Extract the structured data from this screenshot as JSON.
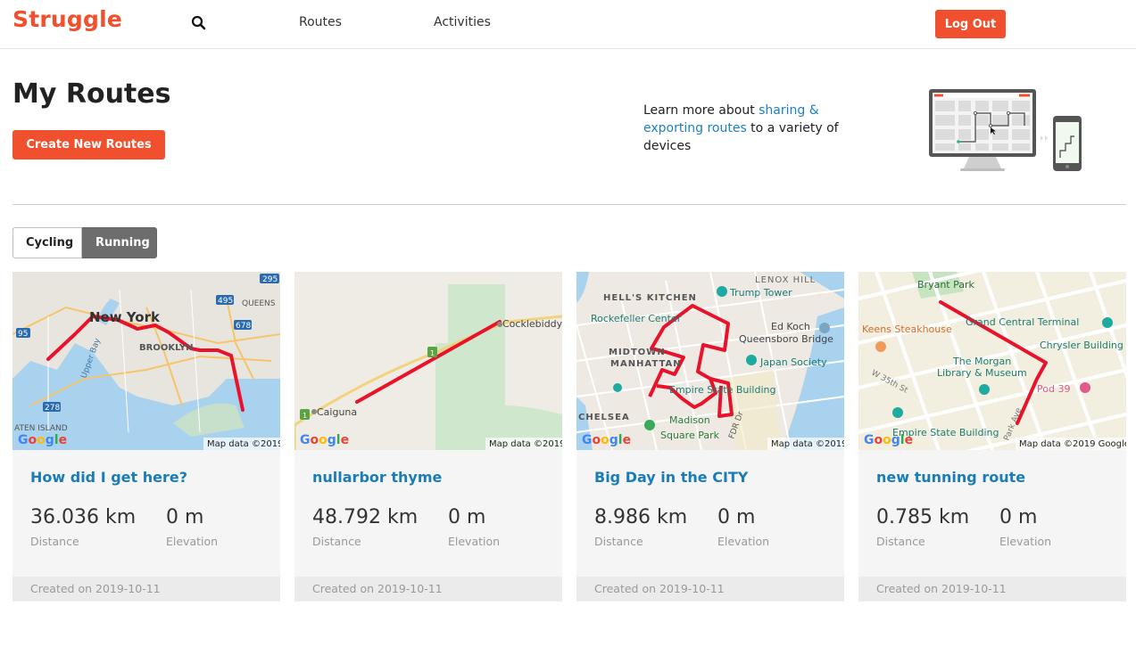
{
  "header": {
    "logo": "Struggle",
    "nav": [
      "Routes",
      "Activities"
    ],
    "logout_label": "Log Out"
  },
  "page": {
    "title": "My Routes",
    "create_label": "Create New Routes",
    "promo_prefix": "Learn more about ",
    "promo_link": "sharing & exporting routes",
    "promo_suffix": " to a variety of devices",
    "filter_tabs": [
      "Cycling",
      "Running"
    ],
    "selected_tab": "Running"
  },
  "cards": [
    {
      "title": "How did I get here?",
      "distance": "36.036 km",
      "distance_label": "Distance",
      "elevation": "0 m",
      "elevation_label": "Elevation",
      "created": "Created on 2019-10-11",
      "map_credit": "Map data ©2019",
      "map_labels": [
        "New York",
        "BROOKLYN",
        "Upper Bay",
        "QUEENS",
        "ATEN ISLAND"
      ]
    },
    {
      "title": "nullarbor thyme",
      "distance": "48.792 km",
      "distance_label": "Distance",
      "elevation": "0 m",
      "elevation_label": "Elevation",
      "created": "Created on 2019-10-11",
      "map_credit": "Map data ©2019",
      "map_labels": [
        "Cocklebiddy",
        "Caiguna"
      ]
    },
    {
      "title": "Big Day in the CITY",
      "distance": "8.986 km",
      "distance_label": "Distance",
      "elevation": "0 m",
      "elevation_label": "Elevation",
      "created": "Created on 2019-10-11",
      "map_credit": "Map data ©2019",
      "map_labels": [
        "LENOX HILL",
        "HELL'S KITCHEN",
        "Trump Tower",
        "Rockefeller Center",
        "Ed Koch",
        "Queensboro Bridge",
        "MIDTOWN",
        "MANHATTAN",
        "Japan Society",
        "Empire State Building",
        "CHELSEA",
        "Madison",
        "Square Park",
        "FDR Dr"
      ]
    },
    {
      "title": "new tunning route",
      "distance": "0.785 km",
      "distance_label": "Distance",
      "elevation": "0 m",
      "elevation_label": "Elevation",
      "created": "Created on 2019-10-11",
      "map_credit": "Map data ©2019 Google",
      "map_labels": [
        "Bryant Park",
        "Grand Central Terminal",
        "Keens Steakhouse",
        "Chrysler Building",
        "The Morgan",
        "Library & Museum",
        "W 35th St",
        "Pod 39",
        "Empire State Building",
        "Park Ave"
      ]
    }
  ],
  "colors": {
    "brand": "#f0502d",
    "link": "#1a7db8",
    "route": "#e8132b"
  },
  "icons": {
    "search": "search-icon",
    "promo": "devices-illustration"
  }
}
